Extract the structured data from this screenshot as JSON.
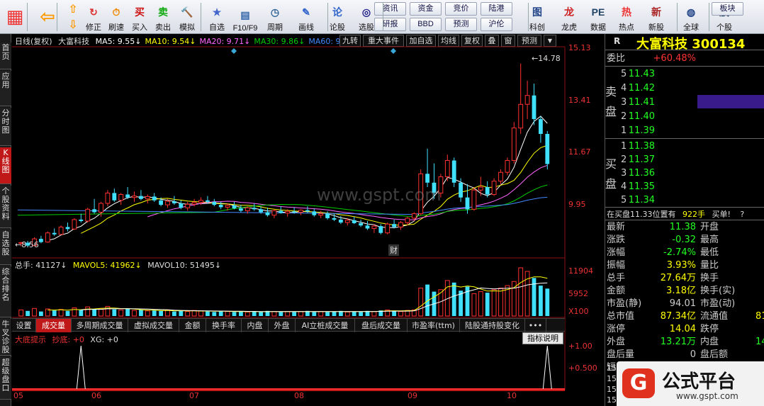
{
  "toolbar": {
    "main_buttons": [
      "修正",
      "刷速",
      "买入",
      "卖出",
      "模拟",
      "自选",
      "F10/F9",
      "周期",
      "画线",
      "论股",
      "选股",
      "科创",
      "龙虎",
      "数据",
      "热点",
      "新股",
      "全球",
      "个股"
    ],
    "small_buttons": [
      "资讯",
      "资金",
      "竞价",
      "陆港",
      "研报",
      "BBD",
      "预测",
      "沪伦",
      "板块"
    ]
  },
  "left_tabs": [
    "首页",
    "应用",
    "分时图",
    "K线图",
    "个股资料",
    "自选股",
    "综合排名",
    "牛叉诊股",
    "超级盘口"
  ],
  "chart": {
    "info_label": "日线(复权)",
    "stock_name": "大富科技",
    "ma": [
      {
        "label": "MA5: 9.55↓",
        "color": "#ffffff"
      },
      {
        "label": "MA10: 9.54↓",
        "color": "#ffff00"
      },
      {
        "label": "MA20: 9.71↓",
        "color": "#ff66ff"
      },
      {
        "label": "MA30: 9.86↓",
        "color": "#00cc00"
      },
      {
        "label": "MA60: 9.",
        "color": "#4488ff"
      }
    ],
    "context_menu": [
      "九转",
      "重大事件",
      "加自选",
      "均线",
      "复权",
      "叠",
      "窗",
      "预测"
    ],
    "price_axis": [
      "15.13",
      "13.41",
      "11.67",
      "9.95"
    ],
    "high_label": "14.78",
    "low_label": "8.56",
    "event_marker": "财",
    "watermark": "www.gspt.com",
    "volume_info": [
      "总手: 41127↓",
      "MAVOL5: 41962↓",
      "MAVOL10: 51495↓"
    ],
    "volume_axis": [
      "11904",
      "5952",
      "X100"
    ],
    "bottom_tabs": [
      "设置",
      "成交量",
      "多周期成交量",
      "虚拟成交量",
      "金额",
      "换手率",
      "内盘",
      "外盘",
      "AI立桩成交量",
      "盘后成交量",
      "市盈率(ttm)",
      "陆股通持股变化",
      "•••"
    ],
    "indicator_info": [
      "大底提示",
      "抄底: +0",
      "XG: +0"
    ],
    "indicator_button": "指标说明",
    "indicator_axis": [
      "1.00",
      "0.500"
    ],
    "months": [
      "05",
      "06",
      "07",
      "08",
      "09",
      "10"
    ]
  },
  "quote_panel": {
    "title": "大富科技 300134",
    "r_label": "R",
    "webi": {
      "label": "委比",
      "value": "+60.48%"
    },
    "sell_label": "卖盘",
    "buy_label": "买盘",
    "sell": [
      {
        "lvl": "5",
        "price": "11.43"
      },
      {
        "lvl": "4",
        "price": "11.42"
      },
      {
        "lvl": "3",
        "price": "11.41"
      },
      {
        "lvl": "2",
        "price": "11.40"
      },
      {
        "lvl": "1",
        "price": "11.39"
      }
    ],
    "buy": [
      {
        "lvl": "1",
        "price": "11.38"
      },
      {
        "lvl": "2",
        "price": "11.37"
      },
      {
        "lvl": "3",
        "price": "11.36"
      },
      {
        "lvl": "4",
        "price": "11.35"
      },
      {
        "lvl": "5",
        "price": "11.34"
      }
    ],
    "tape": {
      "text": "在买盘11.33位置有",
      "vol": "922手",
      "action": "买单!",
      "flag": "?"
    },
    "stats": [
      {
        "l": "最新",
        "v": "11.38",
        "r": "开盘"
      },
      {
        "l": "涨跌",
        "v": "-0.32",
        "r": "最高"
      },
      {
        "l": "涨幅",
        "v": "-2.74%",
        "r": "最低"
      },
      {
        "l": "振幅",
        "v": "3.93%",
        "r": "量比"
      },
      {
        "l": "总手",
        "v": "27.64万",
        "r": "换手"
      },
      {
        "l": "金额",
        "v": "3.18亿",
        "r": "换手(实)"
      },
      {
        "l": "市盈(静)",
        "v": "94.01",
        "r": "市盈(动)"
      },
      {
        "l": "总市值",
        "v": "87.34亿",
        "r": "流通值"
      },
      {
        "l": "涨停",
        "v": "14.04",
        "r": "跌停"
      },
      {
        "l": "外盘",
        "v": "13.21万",
        "r": "内盘"
      },
      {
        "l": "盘后量",
        "v": "0",
        "r": "盘后额"
      },
      {
        "l": "短",
        "v": "",
        "r": ""
      }
    ],
    "stats_extra": {
      "lt": "81",
      "np": "14"
    },
    "logo_text": "公式平台",
    "logo_url": "www.gspt.com",
    "side_nums": [
      "15",
      "15",
      "15",
      "15"
    ]
  },
  "candles": [
    [
      8.7,
      8.75,
      8.6,
      8.72
    ],
    [
      8.72,
      8.78,
      8.56,
      8.62
    ],
    [
      8.62,
      8.9,
      8.6,
      8.85
    ],
    [
      8.85,
      8.95,
      8.7,
      8.74
    ],
    [
      8.74,
      9.1,
      8.72,
      9.05
    ],
    [
      9.05,
      9.2,
      8.95,
      9.0
    ],
    [
      9.0,
      9.3,
      8.98,
      9.25
    ],
    [
      9.25,
      9.4,
      9.1,
      9.18
    ],
    [
      9.18,
      9.55,
      9.15,
      9.5
    ],
    [
      9.5,
      9.7,
      9.4,
      9.45
    ],
    [
      9.45,
      9.9,
      9.4,
      9.85
    ],
    [
      9.85,
      10.2,
      9.7,
      9.75
    ],
    [
      9.75,
      10.1,
      9.6,
      10.05
    ],
    [
      10.05,
      10.5,
      9.95,
      10.4
    ],
    [
      10.4,
      10.55,
      10.1,
      10.15
    ],
    [
      10.15,
      10.4,
      10.0,
      10.35
    ],
    [
      10.35,
      10.6,
      10.2,
      10.25
    ],
    [
      10.25,
      10.45,
      10.1,
      10.3
    ],
    [
      10.3,
      10.5,
      10.15,
      10.2
    ],
    [
      10.2,
      10.35,
      10.05,
      10.28
    ],
    [
      10.28,
      10.4,
      10.1,
      10.15
    ],
    [
      10.15,
      10.25,
      9.95,
      10.0
    ],
    [
      10.0,
      10.2,
      9.9,
      10.12
    ],
    [
      10.12,
      10.3,
      10.0,
      10.05
    ],
    [
      10.05,
      10.15,
      9.85,
      9.9
    ],
    [
      9.9,
      10.1,
      9.8,
      10.02
    ],
    [
      10.02,
      10.2,
      9.95,
      10.08
    ],
    [
      10.08,
      10.25,
      10.0,
      10.15
    ],
    [
      10.15,
      10.3,
      10.05,
      10.1
    ],
    [
      10.1,
      10.2,
      9.95,
      10.0
    ],
    [
      10.0,
      10.1,
      9.85,
      9.92
    ],
    [
      9.92,
      10.05,
      9.8,
      9.98
    ],
    [
      9.98,
      10.1,
      9.85,
      9.88
    ],
    [
      9.88,
      10.0,
      9.75,
      9.8
    ],
    [
      9.8,
      9.95,
      9.7,
      9.9
    ],
    [
      9.9,
      10.05,
      9.8,
      9.85
    ],
    [
      9.85,
      9.95,
      9.7,
      9.75
    ],
    [
      9.75,
      9.9,
      9.6,
      9.65
    ],
    [
      9.65,
      9.85,
      9.55,
      9.8
    ],
    [
      9.8,
      9.95,
      9.7,
      9.72
    ],
    [
      9.72,
      9.85,
      9.6,
      9.78
    ],
    [
      9.78,
      9.92,
      9.7,
      9.75
    ],
    [
      9.75,
      9.85,
      9.65,
      9.82
    ],
    [
      9.82,
      9.95,
      9.72,
      9.78
    ],
    [
      9.78,
      9.88,
      9.6,
      9.65
    ],
    [
      9.65,
      9.8,
      9.55,
      9.7
    ],
    [
      9.7,
      9.78,
      9.5,
      9.55
    ],
    [
      9.55,
      9.7,
      9.45,
      9.5
    ],
    [
      9.5,
      9.62,
      9.35,
      9.4
    ],
    [
      9.4,
      9.55,
      9.3,
      9.48
    ],
    [
      9.48,
      9.6,
      9.35,
      9.38
    ],
    [
      9.38,
      9.5,
      9.25,
      9.3
    ],
    [
      9.3,
      9.45,
      9.15,
      9.2
    ],
    [
      9.2,
      9.35,
      9.05,
      9.28
    ],
    [
      9.28,
      9.35,
      9.0,
      9.05
    ],
    [
      9.05,
      9.4,
      9.0,
      9.35
    ],
    [
      9.35,
      9.5,
      9.2,
      9.25
    ],
    [
      9.25,
      9.45,
      9.15,
      9.4
    ],
    [
      9.4,
      9.6,
      9.3,
      9.55
    ],
    [
      9.55,
      9.75,
      9.45,
      9.7
    ],
    [
      9.7,
      11.2,
      9.65,
      11.05
    ],
    [
      11.05,
      11.9,
      10.6,
      10.75
    ],
    [
      10.75,
      11.4,
      10.2,
      10.4
    ],
    [
      10.4,
      11.05,
      10.25,
      10.95
    ],
    [
      10.95,
      11.7,
      10.8,
      11.5
    ],
    [
      11.5,
      11.6,
      10.6,
      10.75
    ],
    [
      10.75,
      10.9,
      10.1,
      10.25
    ],
    [
      10.25,
      10.7,
      9.7,
      9.85
    ],
    [
      9.85,
      10.6,
      9.8,
      10.5
    ],
    [
      10.5,
      10.95,
      10.3,
      10.6
    ],
    [
      10.6,
      10.8,
      10.25,
      10.35
    ],
    [
      10.35,
      10.9,
      10.3,
      10.8
    ],
    [
      10.8,
      11.2,
      10.7,
      11.1
    ],
    [
      11.1,
      11.6,
      11.0,
      11.5
    ],
    [
      11.5,
      12.8,
      11.4,
      12.6
    ],
    [
      12.6,
      14.78,
      12.4,
      13.4
    ],
    [
      13.4,
      14.2,
      12.9,
      13.7
    ],
    [
      13.7,
      14.1,
      12.7,
      12.9
    ],
    [
      12.9,
      13.0,
      12.1,
      12.4
    ],
    [
      12.4,
      12.5,
      11.2,
      11.38
    ]
  ],
  "volumes": [
    12,
    10,
    15,
    9,
    14,
    11,
    13,
    10,
    16,
    12,
    18,
    14,
    15,
    19,
    13,
    12,
    14,
    11,
    12,
    10,
    11,
    10,
    12,
    9,
    10,
    9,
    11,
    10,
    9,
    8,
    10,
    9,
    8,
    9,
    8,
    9,
    8,
    10,
    9,
    8,
    9,
    8,
    9,
    10,
    8,
    9,
    8,
    9,
    10,
    8,
    9,
    8,
    10,
    9,
    11,
    12,
    10,
    9,
    11,
    12,
    55,
    62,
    48,
    52,
    70,
    66,
    50,
    58,
    44,
    48,
    46,
    52,
    55,
    60,
    68,
    95,
    88,
    75,
    60,
    54
  ],
  "signals": [
    9,
    79
  ]
}
